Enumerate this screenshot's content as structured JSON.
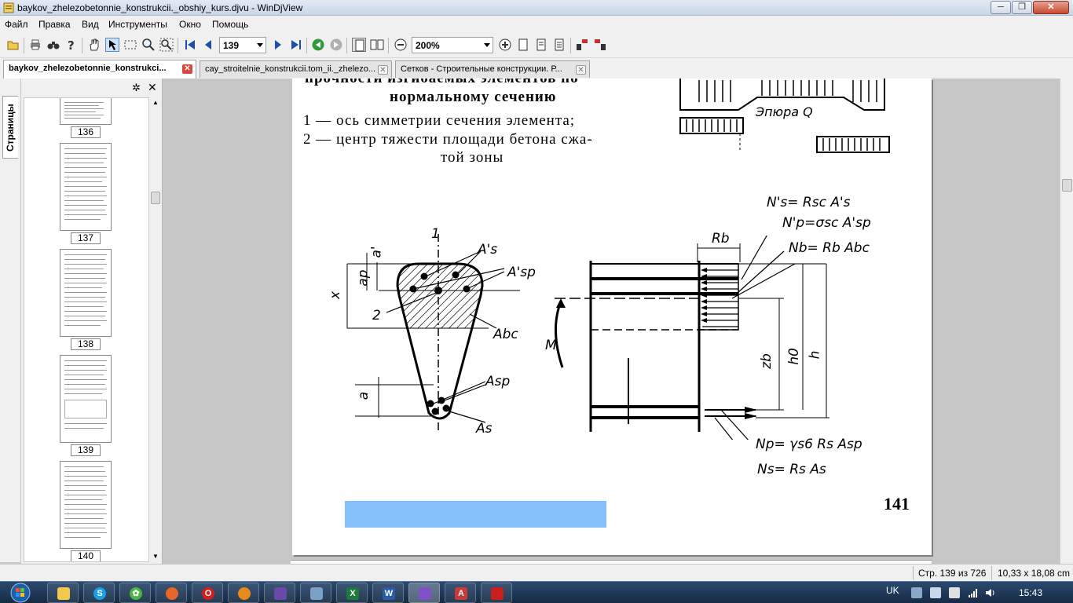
{
  "window": {
    "title": "baykov_zhelezobetonnie_konstrukcii._obshiy_kurs.djvu - WinDjView",
    "buttons": {
      "minimize": "─",
      "maximize": "❐",
      "close": "✕"
    }
  },
  "menu": [
    "Файл",
    "Правка",
    "Вид",
    "Инструменты",
    "Окно",
    "Помощь"
  ],
  "toolbar": {
    "page_value": "139",
    "zoom_value": "200%"
  },
  "tabs": [
    {
      "label": "baykov_zhelezobetonnie_konstrukci...",
      "active": true
    },
    {
      "label": "cay_stroitelnie_konstrukcii.tom_ii._zhelezo...",
      "active": false
    },
    {
      "label": "Сетков - Строительные конструкции. Р...",
      "active": false
    }
  ],
  "sidebar": {
    "tab_label": "Страницы",
    "thumbnails": [
      "136",
      "137",
      "138",
      "139",
      "140"
    ]
  },
  "page": {
    "caption_lines": [
      "прочности   изгибаемых   элементов   по",
      "нормальному сечению",
      "1 — ось  симметрии   сечения   элемента;",
      "2 — центр тяжести площади бетона сжа-",
      "той  зоны"
    ],
    "epure_label": "Эпюра Q",
    "labels": {
      "axis1": "1",
      "as_prime": "A's",
      "asp_prime": "A'sp",
      "a_prime": "a'",
      "ap": "ap",
      "x": "x",
      "two": "2",
      "abc": "Abc",
      "asp": "Asp",
      "a": "a",
      "as": "As",
      "rb": "Rb",
      "m": "M",
      "zb": "zb",
      "h0": "h0",
      "h": "h",
      "ns_top": "N's= Rsc A's",
      "np_top": "N'p=σsc A'sp",
      "nb": "Nb= Rb Abc",
      "np_bottom": "Np= γs6 Rs Asp",
      "ns_bottom": "Ns= Rs As"
    },
    "page_number": "141"
  },
  "status": {
    "page_info": "Стр. 139 из 726",
    "page_size": "10,33 x 18,08 cm"
  },
  "taskbar": {
    "lang": "UK",
    "clock": "15:43",
    "apps": [
      "explorer",
      "skype",
      "utorrent",
      "firefox",
      "opera",
      "avast",
      "winrar",
      "remote",
      "excel",
      "word",
      "winamp",
      "abbyy",
      "acrobat"
    ]
  }
}
